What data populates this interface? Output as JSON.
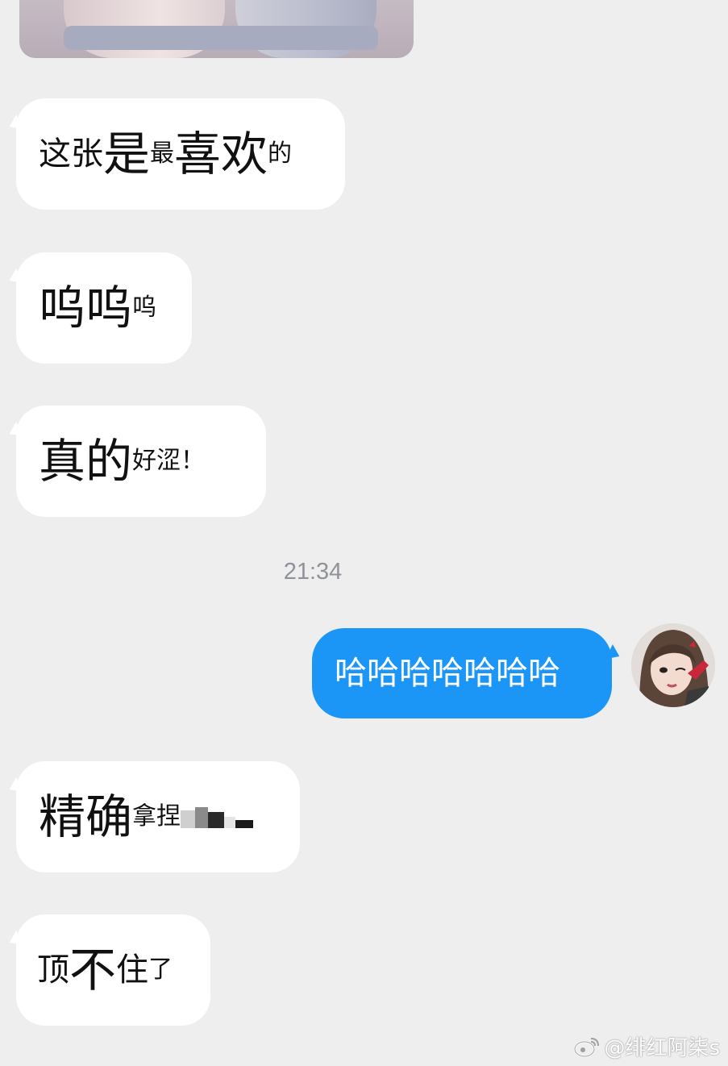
{
  "messages": [
    {
      "id": "m1",
      "direction": "incoming",
      "segments": [
        {
          "text": "这张",
          "size": "m"
        },
        {
          "text": "是",
          "size": "l"
        },
        {
          "text": "最",
          "size": "s"
        },
        {
          "text": "喜欢",
          "size": "l"
        },
        {
          "text": "的",
          "size": "s"
        }
      ]
    },
    {
      "id": "m2",
      "direction": "incoming",
      "segments": [
        {
          "text": "呜呜",
          "size": "l"
        },
        {
          "text": "呜",
          "size": "s"
        }
      ]
    },
    {
      "id": "m3",
      "direction": "incoming",
      "segments": [
        {
          "text": "真的",
          "size": "l"
        },
        {
          "text": "好涩！",
          "size": "s"
        }
      ]
    },
    {
      "id": "m4",
      "direction": "outgoing",
      "segments": [
        {
          "text": "哈哈哈哈哈哈哈",
          "size": "m"
        }
      ]
    },
    {
      "id": "m5",
      "direction": "incoming",
      "segments": [
        {
          "text": "精确",
          "size": "l"
        },
        {
          "text": "拿捏",
          "size": "s"
        }
      ],
      "redacted": true
    },
    {
      "id": "m6",
      "direction": "incoming",
      "segments": [
        {
          "text": "顶",
          "size": "m"
        },
        {
          "text": "不",
          "size": "l"
        },
        {
          "text": "住",
          "size": "m"
        },
        {
          "text": "了",
          "size": "s"
        }
      ]
    }
  ],
  "timestamp": "21:34",
  "watermark": {
    "icon": "weibo-icon",
    "text": "@绯红阿柒s"
  },
  "colors": {
    "background": "#eeeeef",
    "incoming_bubble": "#ffffff",
    "outgoing_bubble": "#1b96f7",
    "timestamp": "#8f9298"
  }
}
